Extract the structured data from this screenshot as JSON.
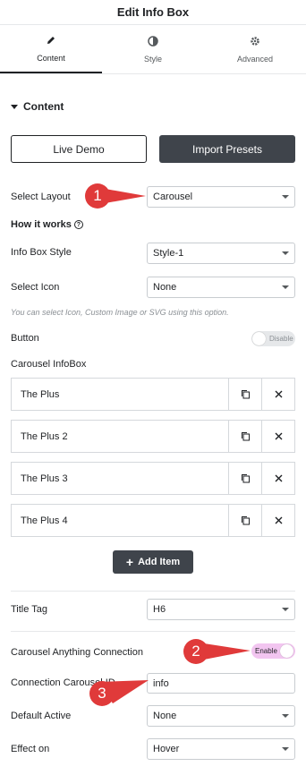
{
  "header": {
    "title": "Edit Info Box"
  },
  "tabs": [
    {
      "label": "Content",
      "icon": "pencil-icon"
    },
    {
      "label": "Style",
      "icon": "half-circle-icon"
    },
    {
      "label": "Advanced",
      "icon": "gear-icon"
    }
  ],
  "section": {
    "title": "Content"
  },
  "buttons": {
    "live_demo": "Live Demo",
    "import_presets": "Import Presets",
    "add_item": "Add Item"
  },
  "fields": {
    "select_layout": {
      "label": "Select Layout",
      "value": "Carousel"
    },
    "how_it_works": "How it works",
    "info_box_style": {
      "label": "Info Box Style",
      "value": "Style-1"
    },
    "select_icon": {
      "label": "Select Icon",
      "value": "None"
    },
    "hint": "You can select Icon, Custom Image or SVG using this option.",
    "button": {
      "label": "Button",
      "toggle": "Disable"
    },
    "carousel_infobox": "Carousel InfoBox",
    "title_tag": {
      "label": "Title Tag",
      "value": "H6"
    },
    "carousel_connection": {
      "label": "Carousel Anything Connection",
      "toggle": "Enable"
    },
    "connection_id": {
      "label": "Connection Carousel ID",
      "value": "info"
    },
    "default_active": {
      "label": "Default Active",
      "value": "None"
    },
    "effect_on": {
      "label": "Effect on",
      "value": "Hover"
    }
  },
  "repeater": [
    {
      "title": "The Plus"
    },
    {
      "title": "The Plus 2"
    },
    {
      "title": "The Plus 3"
    },
    {
      "title": "The Plus 4"
    }
  ],
  "callouts": [
    "1",
    "2",
    "3"
  ],
  "colors": {
    "accent_dark": "#3f444b",
    "callout_red": "#e03a3a",
    "toggle_on": "#f2c5f0"
  }
}
